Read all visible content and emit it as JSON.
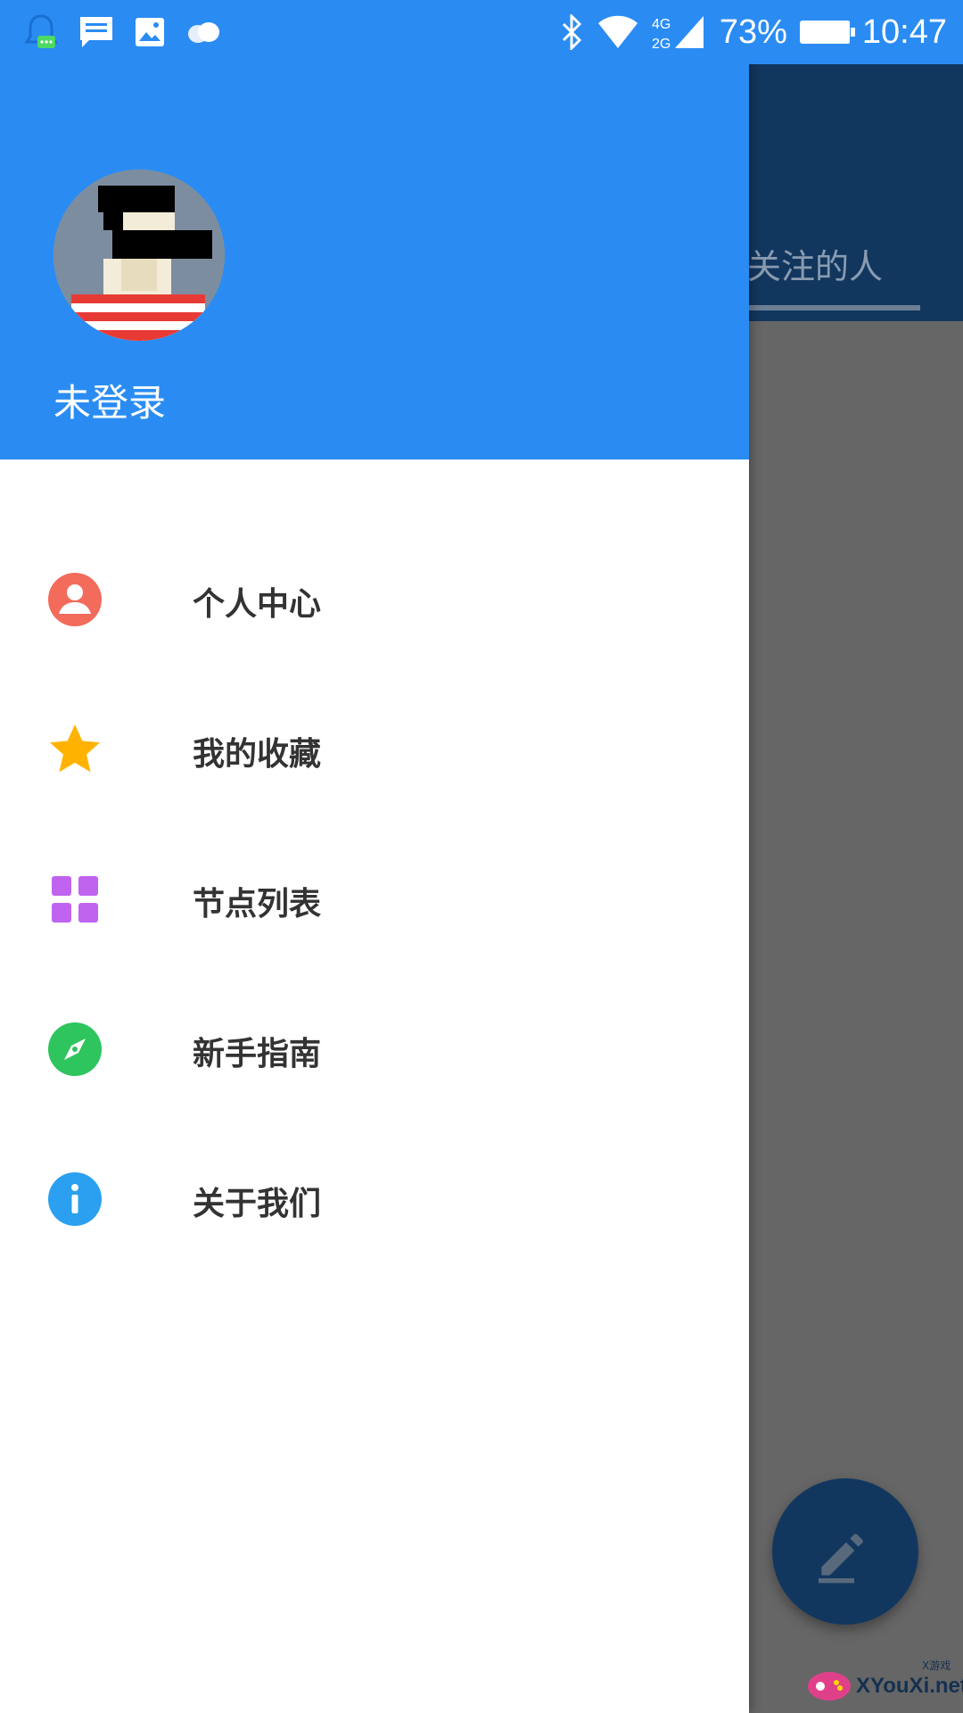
{
  "status_bar": {
    "left_icons": [
      "qq-notification-icon",
      "message-icon",
      "image-icon",
      "weather-icon"
    ],
    "network": "4G 2G",
    "battery_percent": "73%",
    "time": "10:47"
  },
  "background": {
    "tab_label": "关注的人"
  },
  "drawer": {
    "username": "未登录",
    "menu": [
      {
        "label": "个人中心",
        "icon": "profile-icon",
        "color": "#f26b5b"
      },
      {
        "label": "我的收藏",
        "icon": "star-icon",
        "color": "#ffb300"
      },
      {
        "label": "节点列表",
        "icon": "grid-icon",
        "color": "#c064f0"
      },
      {
        "label": "新手指南",
        "icon": "compass-icon",
        "color": "#2ec45e"
      },
      {
        "label": "关于我们",
        "icon": "info-icon",
        "color": "#2ba0f0"
      }
    ]
  },
  "colors": {
    "primary": "#2a8cf3",
    "toolbar_dimmed": "#12375f",
    "scrim": "#666666"
  },
  "watermark": {
    "text": "XYouXi.net",
    "small": "X游戏"
  }
}
